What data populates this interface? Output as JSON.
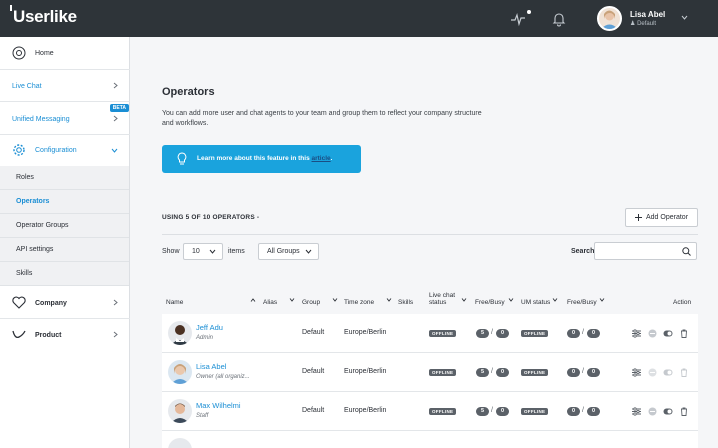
{
  "app": {
    "logo": "Userlike"
  },
  "user": {
    "name": "Lisa Abel",
    "group": "Default"
  },
  "sidebar": {
    "home": "Home",
    "live_chat": "Live Chat",
    "unified_messaging": "Unified Messaging",
    "beta": "BETA",
    "configuration": "Configuration",
    "sub": [
      "Roles",
      "Operators",
      "Operator Groups",
      "API settings",
      "Skills"
    ],
    "company": "Company",
    "product": "Product"
  },
  "page": {
    "title": "Operators",
    "description": "You can add more user and chat agents to your team and group them to reflect your company structure and workflows.",
    "info_text": "Learn more about this feature in this",
    "info_link": "article",
    "info_after": ".",
    "usage": "USING 5 OF 10 OPERATORS -",
    "add_button": "Add Operator",
    "show_label": "Show",
    "show_value": "10",
    "items_label": "items",
    "group_select": "All Groups",
    "search_label": "Search"
  },
  "table": {
    "headers": {
      "name": "Name",
      "alias": "Alias",
      "group": "Group",
      "timezone": "Time zone",
      "skills": "Skills",
      "livechat_1": "Live chat",
      "livechat_2": "status",
      "freebusy": "Free/Busy",
      "um_status": "UM status",
      "freebusy2": "Free/Busy",
      "action": "Action"
    },
    "rows": [
      {
        "name": "Jeff Adu",
        "role": "Admin",
        "group": "Default",
        "timezone": "Europe/Berlin",
        "status": "OFFLINE",
        "free": "5",
        "busy": "0",
        "um": "OFFLINE",
        "free2": "0",
        "busy2": "0"
      },
      {
        "name": "Lisa Abel",
        "role": "Owner (all organiz...",
        "group": "Default",
        "timezone": "Europe/Berlin",
        "status": "OFFLINE",
        "free": "5",
        "busy": "0",
        "um": "OFFLINE",
        "free2": "0",
        "busy2": "0"
      },
      {
        "name": "Max Wilhelmi",
        "role": "Staff",
        "group": "Default",
        "timezone": "Europe/Berlin",
        "status": "OFFLINE",
        "free": "5",
        "busy": "0",
        "um": "OFFLINE",
        "free2": "0",
        "busy2": "0"
      }
    ]
  },
  "colors": {
    "topbar": "#2e3439",
    "accent": "#1a8ed4",
    "info": "#1aa3dd",
    "badge": "#5b6168"
  }
}
